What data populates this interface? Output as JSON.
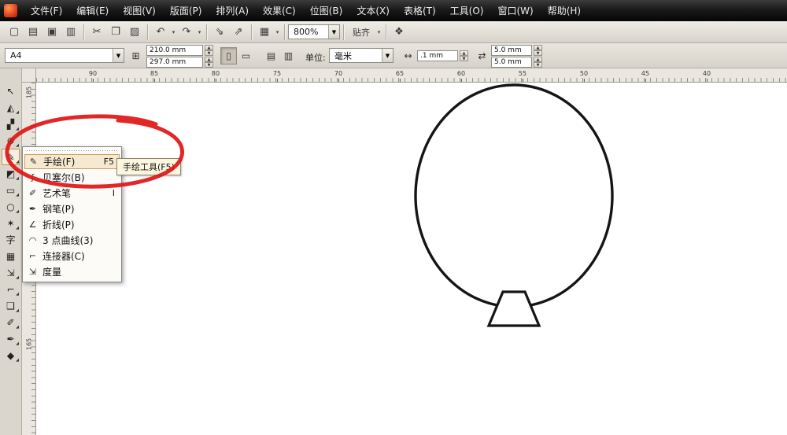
{
  "menubar": {
    "items": [
      "文件(F)",
      "编辑(E)",
      "视图(V)",
      "版面(P)",
      "排列(A)",
      "效果(C)",
      "位图(B)",
      "文本(X)",
      "表格(T)",
      "工具(O)",
      "窗口(W)",
      "帮助(H)"
    ]
  },
  "toolbar": {
    "buttons": [
      {
        "name": "new-document",
        "glyph": "▢"
      },
      {
        "name": "open-document",
        "glyph": "▤"
      },
      {
        "name": "save-document",
        "glyph": "▣"
      },
      {
        "name": "print-document",
        "glyph": "▥"
      },
      {
        "name": "cut",
        "glyph": "✂"
      },
      {
        "name": "copy",
        "glyph": "❐"
      },
      {
        "name": "paste",
        "glyph": "▨"
      },
      {
        "name": "undo",
        "glyph": "↶"
      },
      {
        "name": "redo",
        "glyph": "↷"
      },
      {
        "name": "import",
        "glyph": "⇘"
      },
      {
        "name": "export",
        "glyph": "⇗"
      },
      {
        "name": "app-launcher",
        "glyph": "▦"
      }
    ],
    "dropdown_glyph": "▼",
    "zoom_value": "800%",
    "snap_label": "贴齐",
    "options_glyph": "❖"
  },
  "propbar": {
    "paper_size": "A4",
    "page_metrics_glyph": "⊞",
    "width": "210.0 mm",
    "height": "297.0 mm",
    "portrait_glyph": "▯",
    "landscape_glyph": "▭",
    "all_pages_glyph": "▤",
    "current_page_glyph": "▥",
    "units_label": "单位:",
    "units_value": "毫米",
    "nudge_glyph": "↔",
    "nudge_value": ".1 mm",
    "dup_glyph": "⇄",
    "dup_x": "5.0 mm",
    "dup_y": "5.0 mm"
  },
  "rulers": {
    "h": [
      "90",
      "85",
      "80",
      "75",
      "70",
      "65",
      "60",
      "55",
      "50",
      "45",
      "40"
    ],
    "v": [
      "185",
      "165"
    ]
  },
  "toolbox": {
    "flyout_indicator": "◢",
    "tools": [
      {
        "name": "pick-tool",
        "glyph": "↖"
      },
      {
        "name": "shape-tool",
        "glyph": "◭"
      },
      {
        "name": "crop-tool",
        "glyph": "▞"
      },
      {
        "name": "zoom-tool",
        "glyph": "⊕"
      },
      {
        "name": "freehand-tool",
        "glyph": "✎"
      },
      {
        "name": "smart-fill-tool",
        "glyph": "◩"
      },
      {
        "name": "rectangle-tool",
        "glyph": "▭"
      },
      {
        "name": "ellipse-tool",
        "glyph": "○"
      },
      {
        "name": "polygon-tool",
        "glyph": "✶"
      },
      {
        "name": "text-tool",
        "glyph": "字"
      },
      {
        "name": "table-tool",
        "glyph": "▦"
      },
      {
        "name": "dimension-tool",
        "glyph": "⇲"
      },
      {
        "name": "connector-tool",
        "glyph": "⌐"
      },
      {
        "name": "effects-tool",
        "glyph": "❑"
      },
      {
        "name": "eyedropper-tool",
        "glyph": "✐"
      },
      {
        "name": "outline-pen-tool",
        "glyph": "✒"
      },
      {
        "name": "fill-tool",
        "glyph": "◆"
      }
    ]
  },
  "flyout": {
    "items": [
      {
        "glyph": "✎",
        "label": "手绘(F)",
        "shortcut": "F5"
      },
      {
        "glyph": "ʃ",
        "label": "贝塞尔(B)",
        "shortcut": ""
      },
      {
        "glyph": "✐",
        "label": "艺术笔",
        "shortcut": "I"
      },
      {
        "glyph": "✒",
        "label": "钢笔(P)",
        "shortcut": ""
      },
      {
        "glyph": "∠",
        "label": "折线(P)",
        "shortcut": ""
      },
      {
        "glyph": "◠",
        "label": "3 点曲线(3)",
        "shortcut": ""
      },
      {
        "glyph": "⌐",
        "label": "连接器(C)",
        "shortcut": ""
      },
      {
        "glyph": "⇲",
        "label": "度量",
        "shortcut": ""
      }
    ]
  },
  "tooltip": {
    "text": "手绘工具(F5)"
  },
  "annotation": {
    "color": "#e01515"
  }
}
